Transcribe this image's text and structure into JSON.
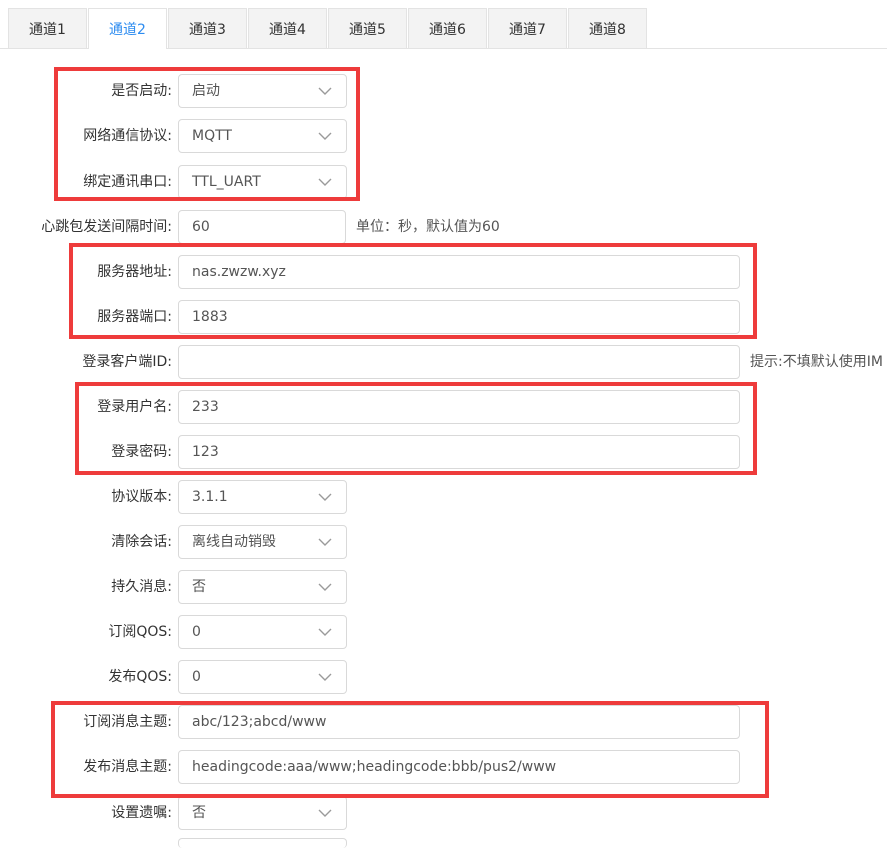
{
  "tabs": [
    "通道1",
    "通道2",
    "通道3",
    "通道4",
    "通道5",
    "通道6",
    "通道7",
    "通道8"
  ],
  "active_tab": "通道2",
  "form": {
    "enable": {
      "label": "是否启动:",
      "value": "启动"
    },
    "protocol": {
      "label": "网络通信协议:",
      "value": "MQTT"
    },
    "serial": {
      "label": "绑定通讯串口:",
      "value": "TTL_UART"
    },
    "heartbeat": {
      "label": "心跳包发送间隔时间:",
      "value": "60",
      "hint": "单位：秒，默认值为60"
    },
    "server_addr": {
      "label": "服务器地址:",
      "value": "nas.zwzw.xyz"
    },
    "server_port": {
      "label": "服务器端口:",
      "value": "1883"
    },
    "client_id": {
      "label": "登录客户端ID:",
      "value": "",
      "hint": "提示:不填默认使用IM"
    },
    "username": {
      "label": "登录用户名:",
      "value": "233"
    },
    "password": {
      "label": "登录密码:",
      "value": "123"
    },
    "version": {
      "label": "协议版本:",
      "value": "3.1.1"
    },
    "clean_session": {
      "label": "清除会话:",
      "value": "离线自动销毁"
    },
    "persistent": {
      "label": "持久消息:",
      "value": "否"
    },
    "sub_qos": {
      "label": "订阅QOS:",
      "value": "0"
    },
    "pub_qos": {
      "label": "发布QOS:",
      "value": "0"
    },
    "sub_topic": {
      "label": "订阅消息主题:",
      "value": "abc/123;abcd/www"
    },
    "pub_topic": {
      "label": "发布消息主题:",
      "value": "headingcode:aaa/www;headingcode:bbb/pus2/www"
    },
    "will": {
      "label": "设置遗嘱:",
      "value": "否"
    }
  },
  "colors": {
    "accent": "#2d8cf0",
    "highlight": "#ee3b3b"
  },
  "icons": {
    "select": "chevron-down-icon"
  }
}
